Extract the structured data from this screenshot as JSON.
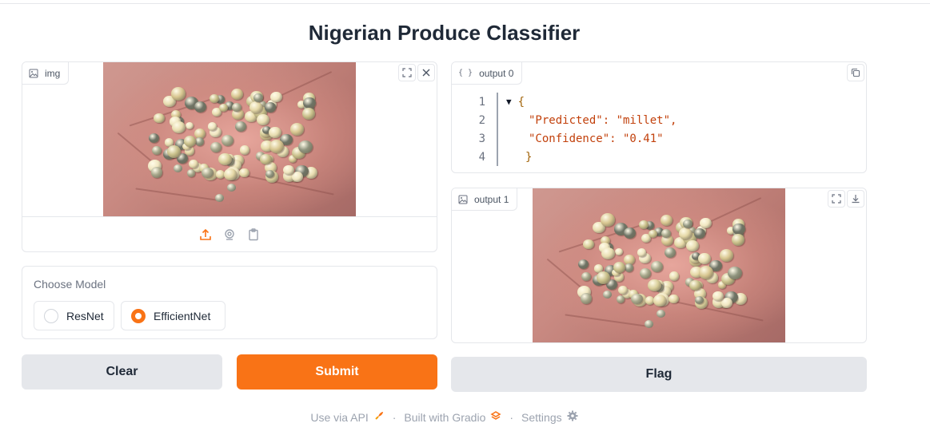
{
  "app": {
    "title": "Nigerian Produce Classifier"
  },
  "input_image": {
    "label": "img"
  },
  "model_choice": {
    "label": "Choose Model",
    "options": [
      "ResNet",
      "EfficientNet"
    ],
    "selected": "EfficientNet"
  },
  "buttons": {
    "clear": "Clear",
    "submit": "Submit",
    "flag": "Flag"
  },
  "output0": {
    "label": "output 0",
    "lines": [
      {
        "n": "1",
        "text": "{"
      },
      {
        "n": "2",
        "text": "\"Predicted\": \"millet\","
      },
      {
        "n": "3",
        "text": "\"Confidence\": \"0.41\""
      },
      {
        "n": "4",
        "text": "}"
      }
    ]
  },
  "output1": {
    "label": "output 1"
  },
  "footer": {
    "api": "Use via API",
    "built": "Built with Gradio",
    "settings": "Settings",
    "separator": "·"
  },
  "colors": {
    "accent": "#f97316",
    "secondary_btn": "#e5e7eb",
    "border": "#e5e7eb"
  },
  "icons": [
    "image-icon",
    "fullscreen-icon",
    "close-icon",
    "upload-icon",
    "webcam-icon",
    "clipboard-icon",
    "json-icon",
    "copy-icon",
    "download-icon",
    "rocket-icon",
    "gradio-logo-icon",
    "gear-icon"
  ]
}
